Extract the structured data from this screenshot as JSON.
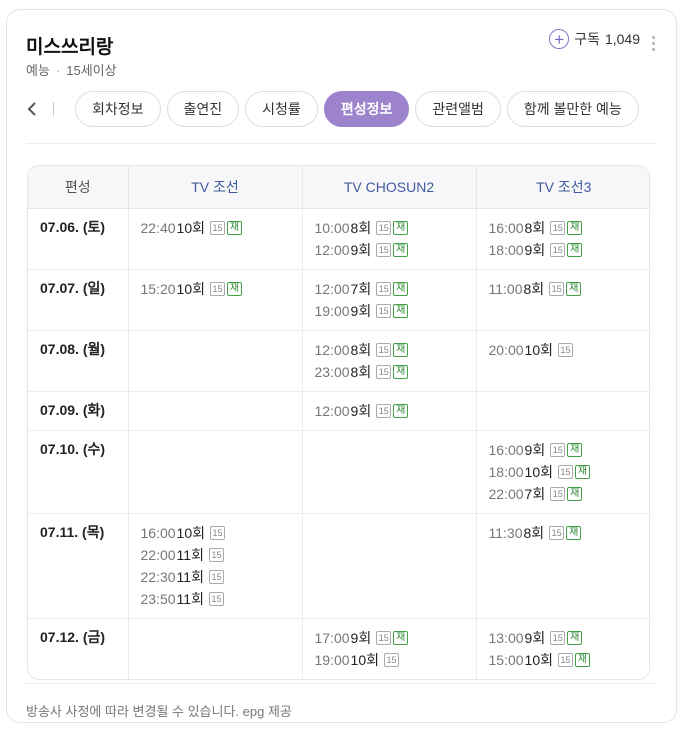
{
  "header": {
    "title": "미스쓰리랑",
    "genre": "예능",
    "rating": "15세이상",
    "subscribe_label": "구독",
    "subscriber_count": "1,049"
  },
  "tabs": [
    {
      "label": "회차정보",
      "active": false
    },
    {
      "label": "출연진",
      "active": false
    },
    {
      "label": "시청률",
      "active": false
    },
    {
      "label": "편성정보",
      "active": true
    },
    {
      "label": "관련앨범",
      "active": false
    },
    {
      "label": "함께 볼만한 예능",
      "active": false
    }
  ],
  "schedule": {
    "date_header": "편성",
    "channels": [
      "TV 조선",
      "TV CHOSUN2",
      "TV 조선3"
    ],
    "rows": [
      {
        "date": "07.06. (토)",
        "cells": [
          [
            {
              "time": "22:40",
              "ep": "10회",
              "age": "15",
              "re": "재"
            }
          ],
          [
            {
              "time": "10:00",
              "ep": "8회",
              "age": "15",
              "re": "재"
            },
            {
              "time": "12:00",
              "ep": "9회",
              "age": "15",
              "re": "재"
            }
          ],
          [
            {
              "time": "16:00",
              "ep": "8회",
              "age": "15",
              "re": "재"
            },
            {
              "time": "18:00",
              "ep": "9회",
              "age": "15",
              "re": "재"
            }
          ]
        ]
      },
      {
        "date": "07.07. (일)",
        "cells": [
          [
            {
              "time": "15:20",
              "ep": "10회",
              "age": "15",
              "re": "재"
            }
          ],
          [
            {
              "time": "12:00",
              "ep": "7회",
              "age": "15",
              "re": "재"
            },
            {
              "time": "19:00",
              "ep": "9회",
              "age": "15",
              "re": "재"
            }
          ],
          [
            {
              "time": "11:00",
              "ep": "8회",
              "age": "15",
              "re": "재"
            }
          ]
        ]
      },
      {
        "date": "07.08. (월)",
        "cells": [
          [],
          [
            {
              "time": "12:00",
              "ep": "8회",
              "age": "15",
              "re": "재"
            },
            {
              "time": "23:00",
              "ep": "8회",
              "age": "15",
              "re": "재"
            }
          ],
          [
            {
              "time": "20:00",
              "ep": "10회",
              "age": "15",
              "re": ""
            }
          ]
        ]
      },
      {
        "date": "07.09. (화)",
        "cells": [
          [],
          [
            {
              "time": "12:00",
              "ep": "9회",
              "age": "15",
              "re": "재"
            }
          ],
          []
        ]
      },
      {
        "date": "07.10. (수)",
        "cells": [
          [],
          [],
          [
            {
              "time": "16:00",
              "ep": "9회",
              "age": "15",
              "re": "재"
            },
            {
              "time": "18:00",
              "ep": "10회",
              "age": "15",
              "re": "재"
            },
            {
              "time": "22:00",
              "ep": "7회",
              "age": "15",
              "re": "재"
            }
          ]
        ]
      },
      {
        "date": "07.11. (목)",
        "cells": [
          [
            {
              "time": "16:00",
              "ep": "10회",
              "age": "15",
              "re": ""
            },
            {
              "time": "22:00",
              "ep": "11회",
              "age": "15",
              "re": ""
            },
            {
              "time": "22:30",
              "ep": "11회",
              "age": "15",
              "re": ""
            },
            {
              "time": "23:50",
              "ep": "11회",
              "age": "15",
              "re": ""
            }
          ],
          [],
          [
            {
              "time": "11:30",
              "ep": "8회",
              "age": "15",
              "re": "재"
            }
          ]
        ]
      },
      {
        "date": "07.12. (금)",
        "cells": [
          [],
          [
            {
              "time": "17:00",
              "ep": "9회",
              "age": "15",
              "re": "재"
            },
            {
              "time": "19:00",
              "ep": "10회",
              "age": "15",
              "re": ""
            }
          ],
          [
            {
              "time": "13:00",
              "ep": "9회",
              "age": "15",
              "re": "재"
            },
            {
              "time": "15:00",
              "ep": "10회",
              "age": "15",
              "re": "재"
            }
          ]
        ]
      }
    ]
  },
  "footer": {
    "note": "방송사 사정에 따라 변경될 수 있습니다. epg 제공"
  },
  "colors": {
    "accent": "#9c83cb",
    "channel_header": "#3f5b9e",
    "rerun_badge": "#43a047"
  },
  "icons": {
    "subscribe": "plus-circle-icon",
    "more": "more-vertical-icon",
    "prev": "chevron-left-icon"
  }
}
